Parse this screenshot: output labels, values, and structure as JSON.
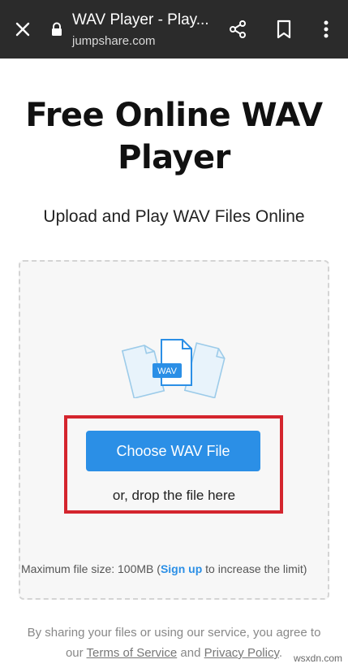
{
  "browser": {
    "tab_title": "WAV Player - Play...",
    "url": "jumpshare.com",
    "icons": [
      "close-icon",
      "lock-icon",
      "share-icon",
      "bookmark-icon",
      "more-vert-icon"
    ],
    "bar_color": "#2b2b2b"
  },
  "page": {
    "headline_line1": "Free Online WAV",
    "headline_line2": "Player",
    "subheadline": "Upload and Play WAV Files Online",
    "upload": {
      "file_badge": "WAV",
      "choose_button": "Choose WAV File",
      "drop_text": "or, drop the file here",
      "limit_prefix": "Maximum file size: 100MB (",
      "signup_link": "Sign up",
      "limit_suffix": " to increase the limit)"
    },
    "footer": {
      "line1": "By sharing your files or using our service, you agree to",
      "our": "our ",
      "terms_link": "Terms of Service",
      "and": " and ",
      "privacy_link": "Privacy Policy",
      "period": "."
    }
  },
  "watermark": "wsxdn.com",
  "colors": {
    "accent": "#2b8fe6",
    "highlight_border": "#d4252e"
  }
}
